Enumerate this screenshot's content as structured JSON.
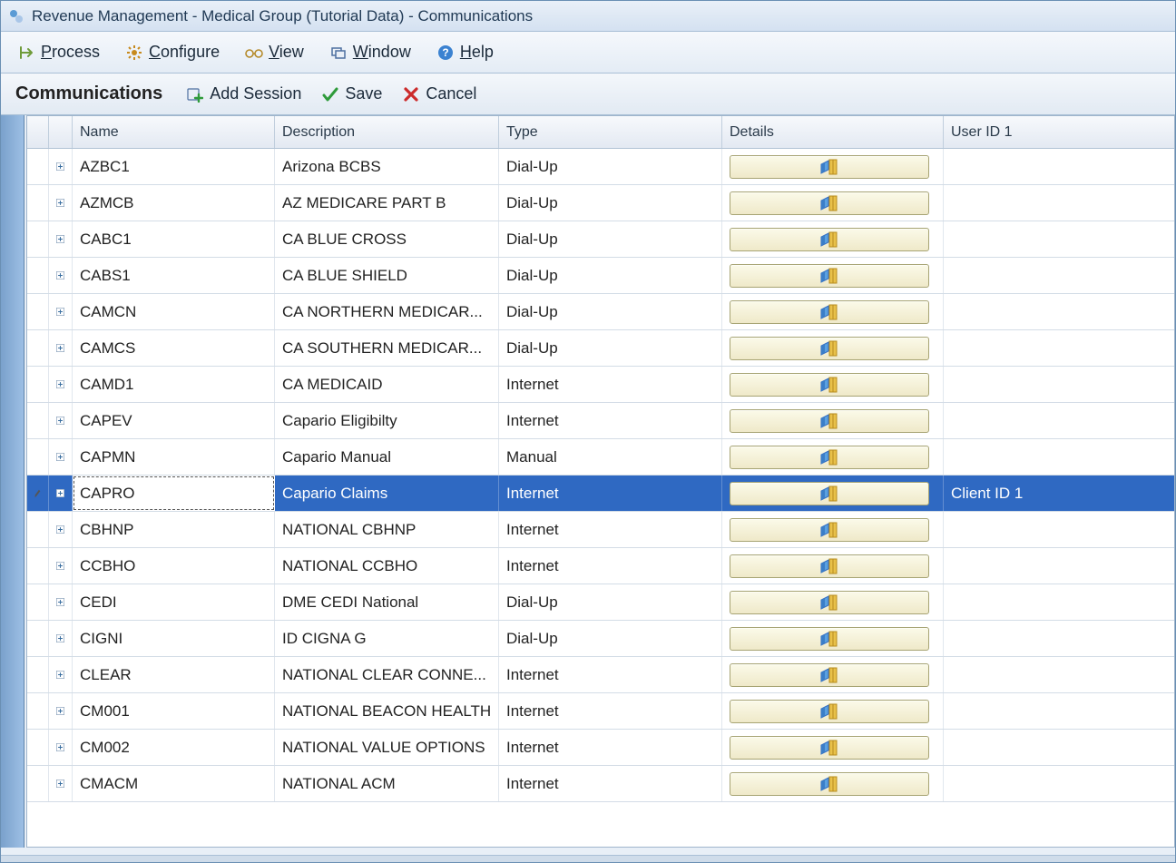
{
  "window": {
    "title": "Revenue Management - Medical Group (Tutorial Data) - Communications"
  },
  "menu": {
    "process": "Process",
    "configure": "Configure",
    "view": "View",
    "window": "Window",
    "help": "Help"
  },
  "toolbar": {
    "heading": "Communications",
    "add_session": "Add Session",
    "save": "Save",
    "cancel": "Cancel"
  },
  "grid": {
    "columns": {
      "name": "Name",
      "description": "Description",
      "type": "Type",
      "details": "Details",
      "userid1": "User ID 1"
    },
    "rows": [
      {
        "name": "AZBC1",
        "description": "Arizona BCBS",
        "type": "Dial-Up",
        "userid1": "",
        "selected": false
      },
      {
        "name": "AZMCB",
        "description": "AZ MEDICARE PART B",
        "type": "Dial-Up",
        "userid1": "",
        "selected": false
      },
      {
        "name": "CABC1",
        "description": "CA BLUE CROSS",
        "type": "Dial-Up",
        "userid1": "",
        "selected": false
      },
      {
        "name": "CABS1",
        "description": "CA BLUE SHIELD",
        "type": "Dial-Up",
        "userid1": "",
        "selected": false
      },
      {
        "name": "CAMCN",
        "description": "CA NORTHERN MEDICAR...",
        "type": "Dial-Up",
        "userid1": "",
        "selected": false
      },
      {
        "name": "CAMCS",
        "description": "CA SOUTHERN MEDICAR...",
        "type": "Dial-Up",
        "userid1": "",
        "selected": false
      },
      {
        "name": "CAMD1",
        "description": "CA MEDICAID",
        "type": "Internet",
        "userid1": "",
        "selected": false
      },
      {
        "name": "CAPEV",
        "description": "Capario Eligibilty",
        "type": "Internet",
        "userid1": "",
        "selected": false
      },
      {
        "name": "CAPMN",
        "description": "Capario Manual",
        "type": "Manual",
        "userid1": "",
        "selected": false
      },
      {
        "name": "CAPRO",
        "description": "Capario Claims",
        "type": "Internet",
        "userid1": "Client ID 1",
        "selected": true
      },
      {
        "name": "CBHNP",
        "description": "NATIONAL CBHNP",
        "type": "Internet",
        "userid1": "",
        "selected": false
      },
      {
        "name": "CCBHO",
        "description": "NATIONAL CCBHO",
        "type": "Internet",
        "userid1": "",
        "selected": false
      },
      {
        "name": "CEDI",
        "description": "DME CEDI National",
        "type": "Dial-Up",
        "userid1": "",
        "selected": false
      },
      {
        "name": "CIGNI",
        "description": "ID CIGNA G",
        "type": "Dial-Up",
        "userid1": "",
        "selected": false
      },
      {
        "name": "CLEAR",
        "description": "NATIONAL CLEAR CONNE...",
        "type": "Internet",
        "userid1": "",
        "selected": false
      },
      {
        "name": "CM001",
        "description": "NATIONAL BEACON HEALTH",
        "type": "Internet",
        "userid1": "",
        "selected": false
      },
      {
        "name": "CM002",
        "description": "NATIONAL VALUE OPTIONS",
        "type": "Internet",
        "userid1": "",
        "selected": false
      },
      {
        "name": "CMACM",
        "description": "NATIONAL ACM",
        "type": "Internet",
        "userid1": "",
        "selected": false
      }
    ]
  }
}
